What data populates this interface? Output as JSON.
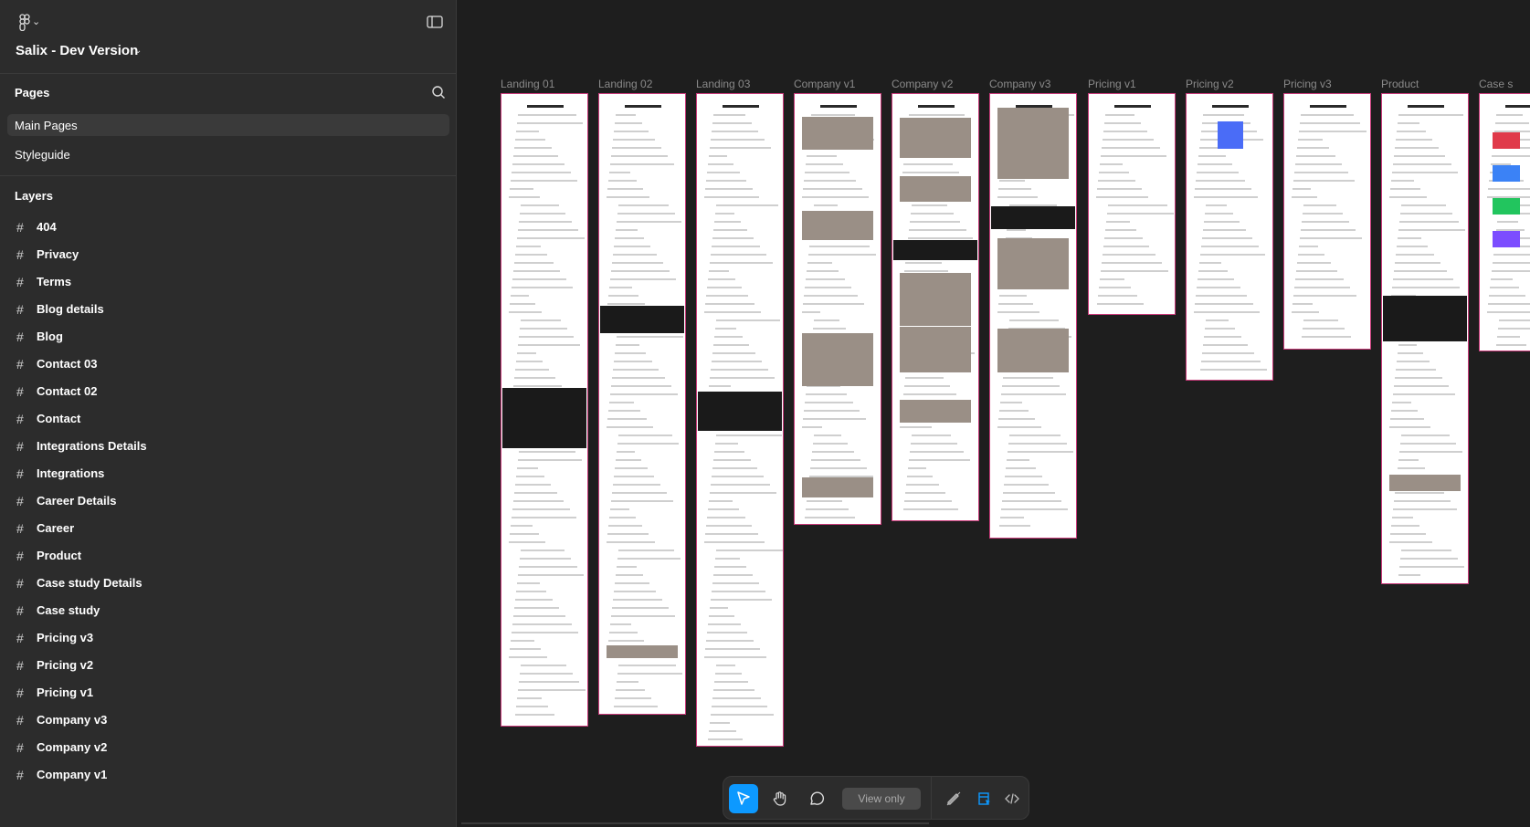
{
  "file": {
    "title": "Salix - Dev Version"
  },
  "pages": {
    "header": "Pages",
    "items": [
      {
        "label": "Main Pages",
        "active": true
      },
      {
        "label": "Styleguide",
        "active": false
      }
    ]
  },
  "layers": {
    "header": "Layers",
    "items": [
      "404",
      "Privacy",
      "Terms",
      "Blog details",
      "Blog",
      "Contact 03",
      "Contact 02",
      "Contact",
      "Integrations Details",
      "Integrations",
      "Career Details",
      "Career",
      "Product",
      "Case study Details",
      "Case study",
      "Pricing v3",
      "Pricing v2",
      "Pricing v1",
      "Company v3",
      "Company v2",
      "Company v1"
    ]
  },
  "canvas": {
    "frames": [
      {
        "label": "Landing 01",
        "variant": "landing1"
      },
      {
        "label": "Landing 02",
        "variant": "landing2"
      },
      {
        "label": "Landing 03",
        "variant": "landing3"
      },
      {
        "label": "Company v1",
        "variant": "company1"
      },
      {
        "label": "Company v2",
        "variant": "company2"
      },
      {
        "label": "Company v3",
        "variant": "company3"
      },
      {
        "label": "Pricing v1",
        "variant": "pricing1"
      },
      {
        "label": "Pricing v2",
        "variant": "pricing2"
      },
      {
        "label": "Pricing v3",
        "variant": "pricing3"
      },
      {
        "label": "Product",
        "variant": "product"
      },
      {
        "label": "Case s",
        "variant": "case"
      }
    ]
  },
  "toolbar": {
    "view_only_label": "View only",
    "tools": [
      "move-tool",
      "hand-tool",
      "comment-tool",
      "annotate-tool",
      "design-mode",
      "dev-mode"
    ],
    "active_tool": "move-tool"
  },
  "colors": {
    "accent": "#0d99ff",
    "sidebar_bg": "#2c2c2c",
    "canvas_bg": "#1e1e1e",
    "frame_border": "#c93a7a"
  }
}
